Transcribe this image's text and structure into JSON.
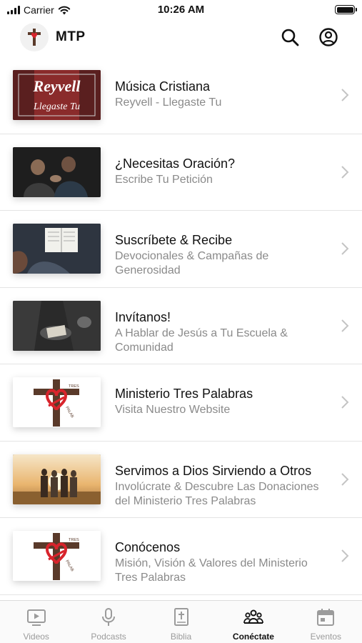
{
  "status_bar": {
    "carrier": "Carrier",
    "time": "10:26 AM"
  },
  "header": {
    "title": "MTP",
    "icons": [
      "search-icon",
      "account-icon"
    ]
  },
  "rows": [
    {
      "title": "Música Cristiana",
      "subtitle": "Reyvell - Llegaste Tu",
      "thumb_text_1": "Reyvell",
      "thumb_text_2": "Llegaste Tu"
    },
    {
      "title": "¿Necesitas Oración?",
      "subtitle": "Escribe Tu Petición"
    },
    {
      "title": "Suscríbete & Recibe",
      "subtitle": "Devocionales & Campañas de Generosidad"
    },
    {
      "title": "Invítanos!",
      "subtitle": "A Hablar de Jesús a Tu Escuela & Comunidad"
    },
    {
      "title": "Ministerio Tres Palabras",
      "subtitle": "Visita Nuestro Website",
      "thumb_text_1": "TRES",
      "thumb_text_2": "PALAB"
    },
    {
      "title": "Servimos a Dios Sirviendo a Otros",
      "subtitle": "Involúcrate & Descubre Las Donaciones del Ministerio Tres Palabras"
    },
    {
      "title": "Conócenos",
      "subtitle": "Misión, Visión & Valores del Ministerio Tres Palabras",
      "thumb_text_1": "TRES",
      "thumb_text_2": "PALAB"
    }
  ],
  "tabs": [
    {
      "label": "Videos",
      "icon": "video-icon",
      "active": false
    },
    {
      "label": "Podcasts",
      "icon": "microphone-icon",
      "active": false
    },
    {
      "label": "Biblia",
      "icon": "bible-icon",
      "active": false
    },
    {
      "label": "Conéctate",
      "icon": "people-icon",
      "active": true
    },
    {
      "label": "Eventos",
      "icon": "calendar-icon",
      "active": false
    }
  ],
  "colors": {
    "active_tab": "#111111",
    "inactive_tab": "#9b9b9b",
    "subtitle": "#8a8a8a",
    "logo_red": "#d8242c",
    "cross_brown": "#5a3a2a"
  }
}
